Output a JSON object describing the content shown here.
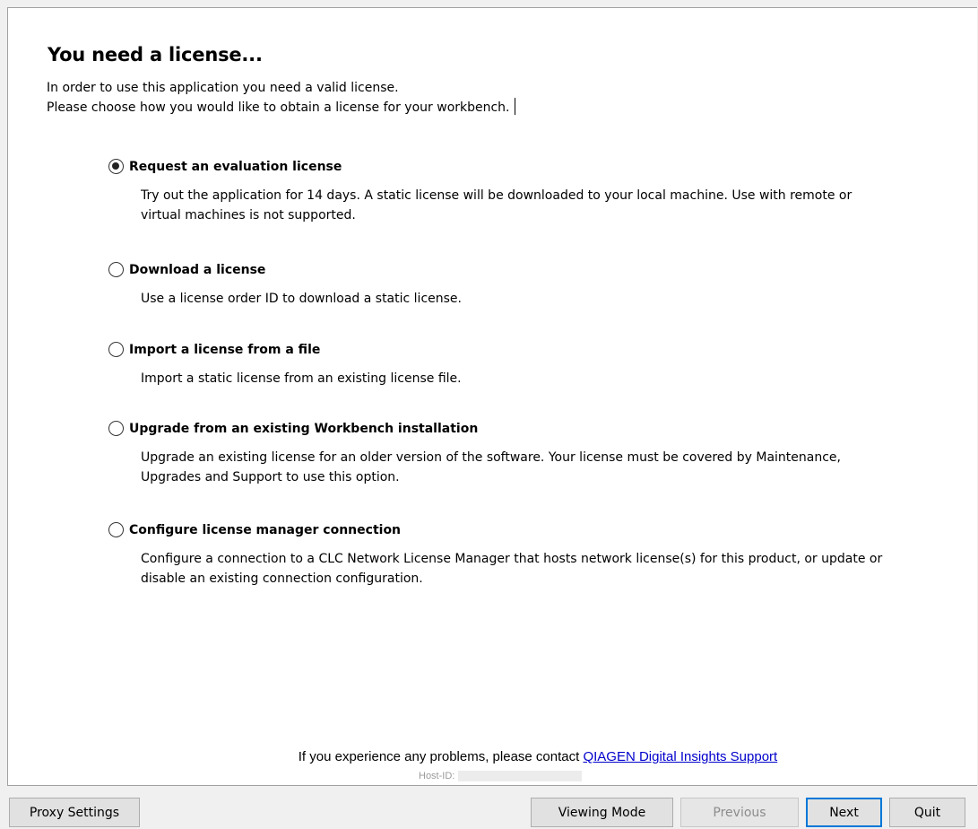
{
  "header": {
    "title": "You need a license...",
    "intro_line1": "In order to use this application you need a valid license.",
    "intro_line2": "Please choose how you would like to obtain a license for your workbench."
  },
  "options": [
    {
      "label": "Request an evaluation license",
      "description": "Try out the application for 14 days. A static license will be downloaded to your local machine. Use with remote or virtual machines is not supported.",
      "selected": true
    },
    {
      "label": "Download a license",
      "description": "Use a license order ID to download a static license.",
      "selected": false
    },
    {
      "label": "Import a license from a file",
      "description": "Import a static license from an existing license file.",
      "selected": false
    },
    {
      "label": "Upgrade from an existing Workbench installation",
      "description": "Upgrade an existing license for an older version of the software. Your license must be covered by Maintenance, Upgrades and Support to use this option.",
      "selected": false
    },
    {
      "label": "Configure license manager connection",
      "description": "Configure a connection to a CLC Network License Manager that hosts network license(s) for this product, or update or disable an existing connection configuration.",
      "selected": false
    }
  ],
  "footer": {
    "contact_text": "If you experience any problems, please contact ",
    "support_link": "QIAGEN Digital Insights Support",
    "host_id_label": "Host-ID:"
  },
  "buttons": {
    "proxy_settings": "Proxy Settings",
    "viewing_mode": "Viewing Mode",
    "previous": "Previous",
    "next": "Next",
    "quit": "Quit"
  },
  "colors": {
    "link": "#0000cc",
    "default_button_border": "#0078d7"
  }
}
